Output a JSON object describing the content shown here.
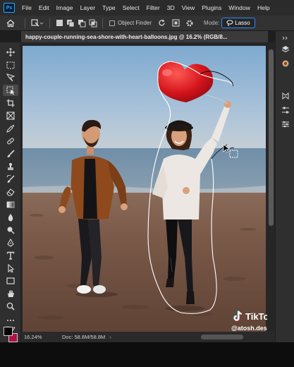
{
  "app": {
    "logo": "Ps"
  },
  "menu": [
    "File",
    "Edit",
    "Image",
    "Layer",
    "Type",
    "Select",
    "Filter",
    "3D",
    "View",
    "Plugins",
    "Window",
    "Help"
  ],
  "options": {
    "object_finder_label": "Object Finder",
    "mode_label": "Mode:",
    "mode_value": "Lasso"
  },
  "document": {
    "tab_title": "happy-couple-running-sea-shore-with-heart-balloons.jpg @ 16.2% (RGB/8..."
  },
  "status": {
    "zoom": "16.24%",
    "doc": "Doc: 58.8M/58.8M"
  },
  "watermark": {
    "brand": "TikTok",
    "handle": "@atosh.designs"
  },
  "colors": {
    "foreground": "#000000",
    "background": "#b0114a",
    "accent": "#2b8bff"
  }
}
